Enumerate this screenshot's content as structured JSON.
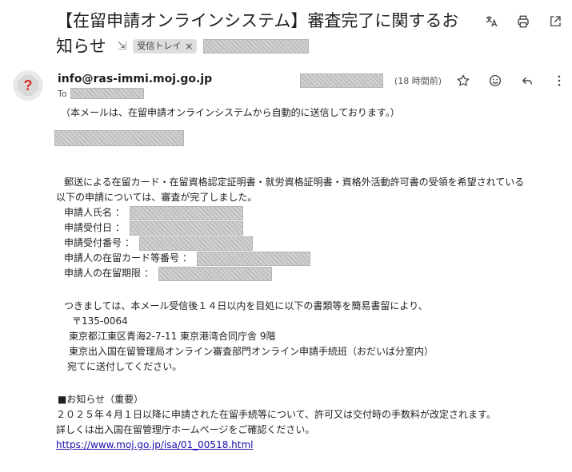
{
  "email": {
    "subject_line1": "【在留申請オンラインシステム】審査完了に関するお",
    "subject_line2": "知らせ",
    "label_chip": "受信トレイ",
    "label_close": "×",
    "from_address": "info@ras-immi.moj.go.jp",
    "to_label": "To",
    "time_ago": "(18 時間前)",
    "icons": {
      "translate": "translate-icon",
      "print": "print-icon",
      "open_new": "open-in-new-window-icon",
      "star": "star-icon",
      "emoji": "emoji-react-icon",
      "reply": "reply-icon",
      "more": "more-vert-icon",
      "avatar": "unknown-sender-avatar"
    },
    "colors": {
      "link": "#1a0dab",
      "avatar_red": "#d93025"
    }
  },
  "body": {
    "auto_notice": "（本メールは、在留申請オンラインシステムから自動的に送信しております。）",
    "para1_line1": "郵送による在留カード・在留資格認定証明書・就労資格証明書・資格外活動許可書の受領を希望されている",
    "para1_line2": "以下の申請については、審査が完了しました。",
    "fields": [
      "申請人氏名 ：",
      "申請受付日 ：",
      "申請受付番号 ：",
      "申請人の在留カード等番号 ：",
      "申請人の在留期限 ："
    ],
    "para2_line1": "つきましては、本メール受信後１４日以内を目処に以下の書類等を簡易書留により、",
    "postal_code": "〒135-0064",
    "address": "東京都江東区青海2-7-11  東京港湾合同庁舎  9階",
    "office": "東京出入国在留管理局オンライン審査部門オンライン申請手続班（おだいば分室内）",
    "send_to": "宛てに送付してください。",
    "notice_title": "■お知らせ（重要）",
    "notice_line1": "２０２５年４月１日以降に申請された在留手続等について、許可又は交付時の手数料が改定されます。",
    "notice_line2": "詳しくは出入国在留管理庁ホームページをご確認ください。",
    "link_text": "https://www.moj.go.jp/isa/01_00518.html"
  }
}
